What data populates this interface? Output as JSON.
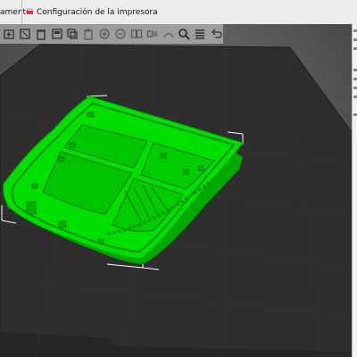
{
  "tabs": [
    {
      "label": "amento",
      "icon": "print-settings-icon"
    },
    {
      "label": "Configuración de la impresora",
      "icon": "printer-icon"
    }
  ],
  "toolbar": {
    "tools": [
      "add-object-icon",
      "delete-icon",
      "delete-all-icon",
      "arrange-icon",
      "copy-icon",
      "paste-icon",
      "add-instance-icon",
      "remove-instance-icon",
      "split-objects-icon",
      "split-parts-icon",
      "variable-layer-icon",
      "search-icon",
      "layers-icon",
      "undo-icon"
    ]
  },
  "colors": {
    "model": "#00dd00",
    "bed": "#2f2f2f",
    "background": "#5a5a5a",
    "selection_box": "#ffffff"
  }
}
